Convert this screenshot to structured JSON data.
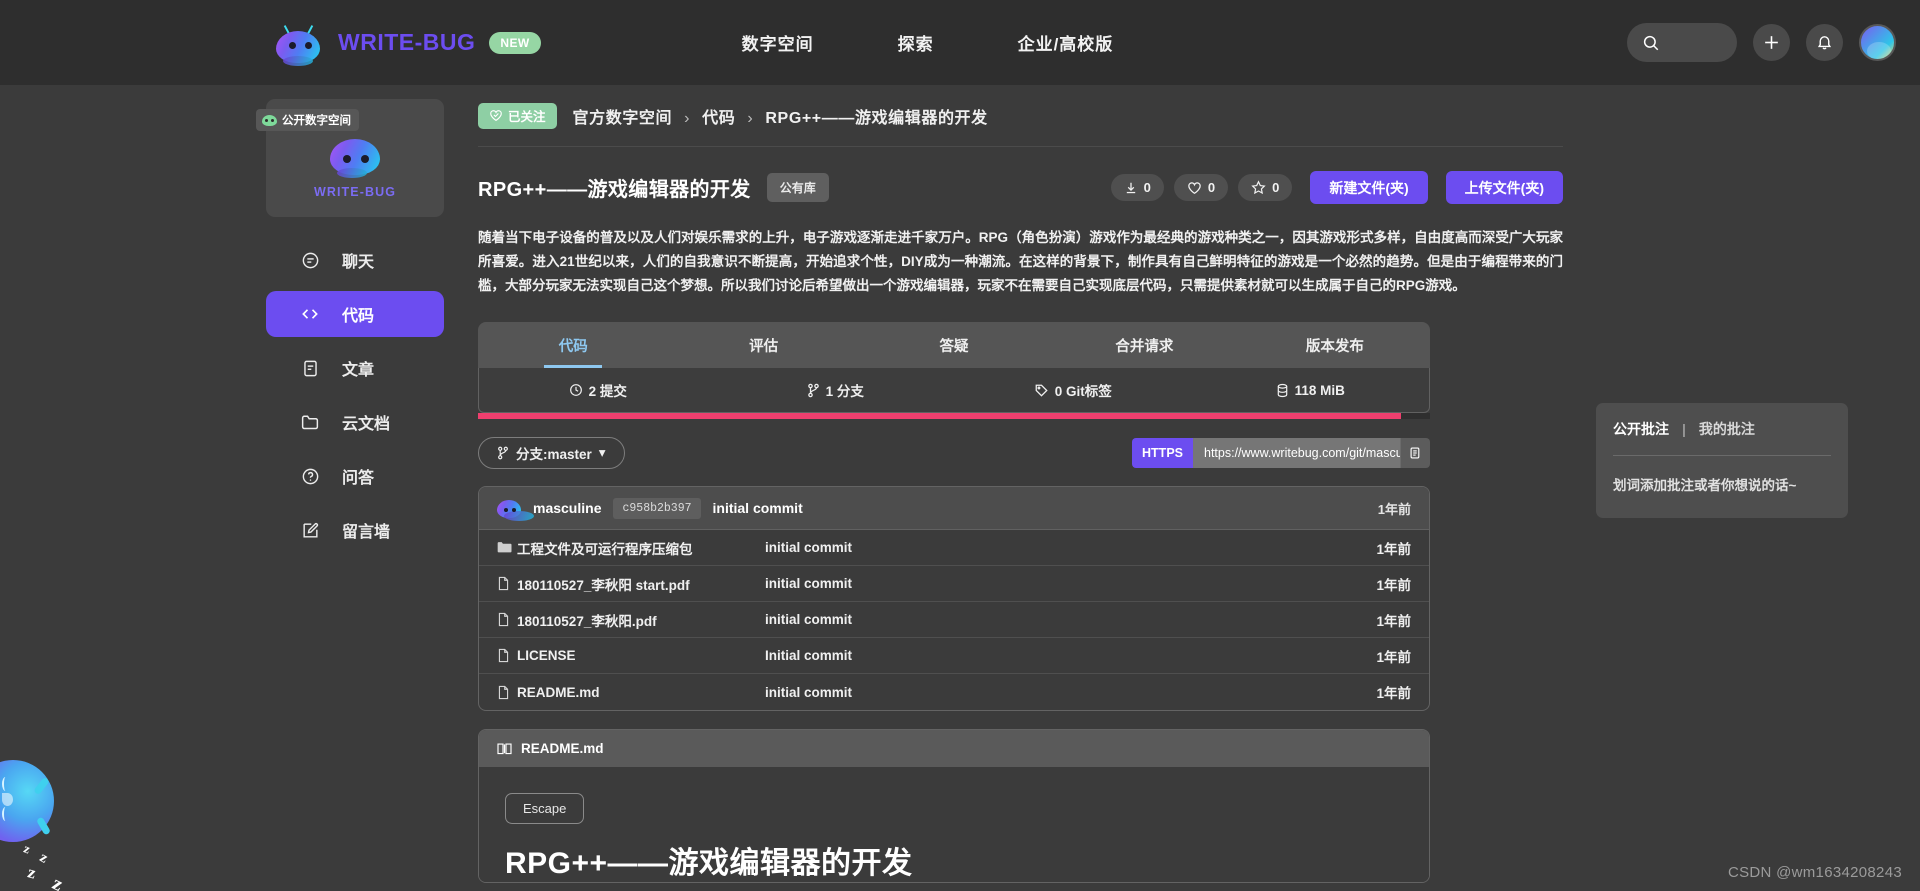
{
  "header": {
    "brand_name": "WRITE-BUG",
    "brand_badge": "NEW",
    "nav": [
      {
        "label": "数字空间"
      },
      {
        "label": "探索"
      },
      {
        "label": "企业/高校版"
      }
    ],
    "search_placeholder": "",
    "icons": [
      "search-icon",
      "plus-icon",
      "bell-icon",
      "avatar"
    ]
  },
  "sidebar": {
    "space_tag": "公开数字空间",
    "space_name": "WRITE-BUG",
    "items": [
      {
        "label": "聊天",
        "icon": "chat-icon",
        "active": false
      },
      {
        "label": "代码",
        "icon": "code-icon",
        "active": true
      },
      {
        "label": "文章",
        "icon": "article-icon",
        "active": false
      },
      {
        "label": "云文档",
        "icon": "folder-icon",
        "active": false
      },
      {
        "label": "问答",
        "icon": "question-icon",
        "active": false
      },
      {
        "label": "留言墙",
        "icon": "edit-icon",
        "active": false
      }
    ]
  },
  "breadcrumb": {
    "follow_label": "已关注",
    "items": [
      "官方数字空间",
      "代码",
      "RPG++——游戏编辑器的开发"
    ],
    "separator": "›"
  },
  "repo": {
    "title": "RPG++——游戏编辑器的开发",
    "visibility": "公有库",
    "stats": [
      {
        "icon": "download-icon",
        "value": "0"
      },
      {
        "icon": "heart-icon",
        "value": "0"
      },
      {
        "icon": "star-icon",
        "value": "0"
      }
    ],
    "buttons": [
      {
        "label": "新建文件(夹)"
      },
      {
        "label": "上传文件(夹)"
      }
    ],
    "description": "随着当下电子设备的普及以及人们对娱乐需求的上升，电子游戏逐渐走进千家万户。RPG（角色扮演）游戏作为最经典的游戏种类之一，因其游戏形式多样，自由度高而深受广大玩家所喜爱。进入21世纪以来，人们的自我意识不断提高，开始追求个性，DIY成为一种潮流。在这样的背景下，制作具有自己鲜明特征的游戏是一个必然的趋势。但是由于编程带来的门槛，大部分玩家无法实现自己这个梦想。所以我们讨论后希望做出一个游戏编辑器，玩家不在需要自己实现底层代码，只需提供素材就可以生成属于自己的RPG游戏。"
  },
  "tabs": [
    {
      "label": "代码",
      "active": true
    },
    {
      "label": "评估",
      "active": false
    },
    {
      "label": "答疑",
      "active": false
    },
    {
      "label": "合并请求",
      "active": false
    },
    {
      "label": "版本发布",
      "active": false
    }
  ],
  "repo_stats": [
    {
      "icon": "clock-icon",
      "label": "2 提交"
    },
    {
      "icon": "branch-icon",
      "label": "1 分支"
    },
    {
      "icon": "tag-icon",
      "label": "0 Git标签"
    },
    {
      "icon": "database-icon",
      "label": "118 MiB"
    }
  ],
  "language_bar": {
    "percent": "97",
    "color": "#ef3f6e"
  },
  "branch": {
    "label": "分支:master",
    "caret": "▾"
  },
  "clone": {
    "protocol": "HTTPS",
    "url": "https://www.writebug.com/git/mascu",
    "copy_icon": "copy-icon"
  },
  "commit": {
    "author": "masculine",
    "hash": "c958b2b397",
    "message": "initial commit",
    "time": "1年前"
  },
  "files": [
    {
      "icon": "folder-icon",
      "name": "工程文件及可运行程序压缩包",
      "message": "initial commit",
      "time": "1年前"
    },
    {
      "icon": "file-icon",
      "name": "180110527_李秋阳 start.pdf",
      "message": "initial commit",
      "time": "1年前"
    },
    {
      "icon": "file-icon",
      "name": "180110527_李秋阳.pdf",
      "message": "initial commit",
      "time": "1年前"
    },
    {
      "icon": "file-icon",
      "name": "LICENSE",
      "message": "Initial commit",
      "time": "1年前"
    },
    {
      "icon": "file-icon",
      "name": "README.md",
      "message": "initial commit",
      "time": "1年前"
    }
  ],
  "readme": {
    "filename": "README.md",
    "escape_label": "Escape",
    "heading": "RPG++——游戏编辑器的开发"
  },
  "annotations": {
    "tab_public": "公开批注",
    "divider": "|",
    "tab_mine": "我的批注",
    "placeholder": "划词添加批注或者你想说的话~"
  },
  "mascot": {
    "zzz": [
      "z",
      "z",
      "z",
      "z"
    ]
  },
  "watermark": "CSDN @wm1634208243",
  "colors": {
    "accent_purple": "#6c4df0",
    "tab_blue": "#8ec8f0",
    "follow_green": "#8ecfa4",
    "lang_pink": "#ef3f6e",
    "page_bg": "#3b3b3b",
    "topbar_bg": "#2e2e2e"
  }
}
